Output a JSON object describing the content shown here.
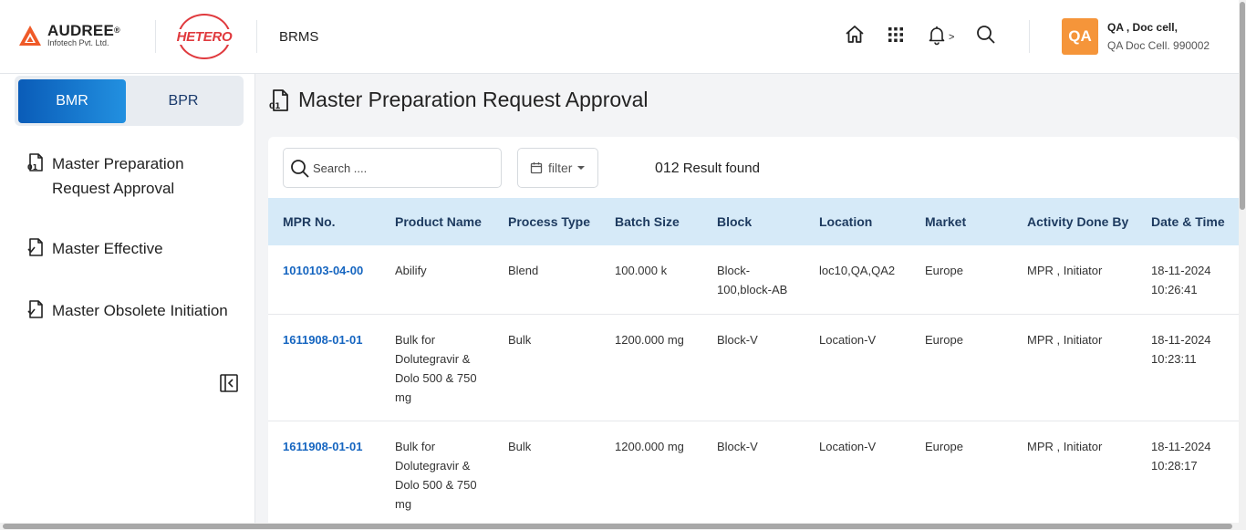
{
  "header": {
    "logo_brand": "AUDREE",
    "logo_reg": "®",
    "logo_sub": "Infotech Pvt. Ltd.",
    "partner_logo": "HETERO",
    "app_name": "BRMS",
    "icons": [
      "home-icon",
      "apps-grid-icon",
      "bell-icon",
      "search-icon"
    ],
    "bell_suffix": ">",
    "user": {
      "initials": "QA",
      "name": "QA , Doc cell,",
      "role": "QA Doc Cell. 990002"
    }
  },
  "sidebar": {
    "toggle": {
      "active": "BMR",
      "inactive": "BPR"
    },
    "items": [
      {
        "label": "Master Preparation\nRequest Approval",
        "icon": "document-number-icon"
      },
      {
        "label": "Master Effective",
        "icon": "document-check-icon"
      },
      {
        "label": "Master Obsolete Initiation",
        "icon": "document-check-icon"
      }
    ]
  },
  "main": {
    "title": "Master Preparation Request Approval",
    "search_placeholder": "Search ....",
    "filter_label": "filter",
    "result_count": "012",
    "result_text": "Result found",
    "columns": [
      "MPR No.",
      "Product Name",
      "Process Type",
      "Batch Size",
      "Block",
      "Location",
      "Market",
      "Activity Done By",
      "Date & Time"
    ],
    "rows": [
      {
        "mpr": "1010103-04-00",
        "product": "Abilify",
        "process": "Blend",
        "batch": "100.000 k",
        "block": "Block-\n100,block-AB",
        "location": "loc10,QA,QA2",
        "market": "Europe",
        "activity": "MPR , Initiator",
        "datetime": "18-11-2024\n10:26:41"
      },
      {
        "mpr": "1611908-01-01",
        "product": "Bulk for\nDolutegravir &\nDolo 500 & 750\nmg",
        "process": "Bulk",
        "batch": "1200.000 mg",
        "block": "Block-V",
        "location": "Location-V",
        "market": "Europe",
        "activity": "MPR , Initiator",
        "datetime": "18-11-2024\n10:23:11"
      },
      {
        "mpr": "1611908-01-01",
        "product": "Bulk for\nDolutegravir &\nDolo 500 & 750\nmg",
        "process": "Bulk",
        "batch": "1200.000 mg",
        "block": "Block-V",
        "location": "Location-V",
        "market": "Europe",
        "activity": "MPR , Initiator",
        "datetime": "18-11-2024\n10:28:17"
      }
    ]
  },
  "colors": {
    "primary": "#0a5cb8",
    "accent_orange": "#f5953a",
    "hetero_red": "#e03a3e",
    "table_header_bg": "#d6eaf8",
    "link": "#1565c0"
  }
}
